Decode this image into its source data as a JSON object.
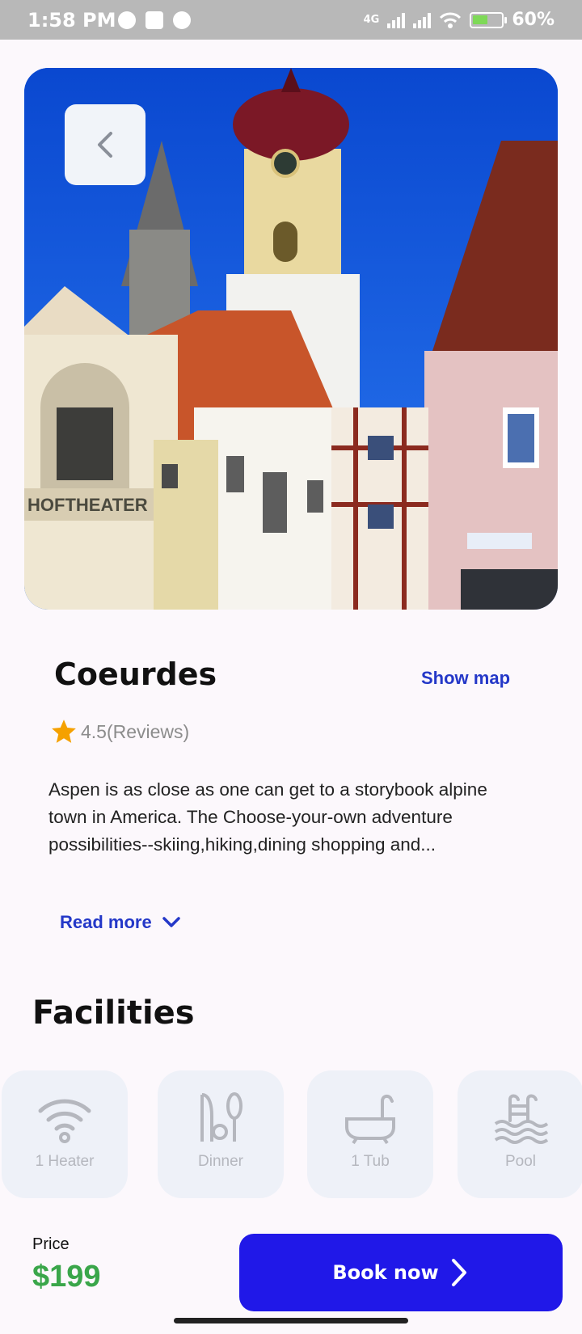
{
  "status_bar": {
    "time": "1:58 PM",
    "network": "4G",
    "battery": "60%"
  },
  "hero": {
    "back_icon": "chevron-left-icon",
    "image_description": "Colorful old town buildings with church tower under a blue sky"
  },
  "place": {
    "name": "Coeurdes",
    "show_map_label": "Show map",
    "rating": "4.5(Reviews)",
    "description": "Aspen is as close as one can get to a storybook alpine town in America. The Choose-your-own adventure possibilities--skiing,hiking,dining shopping and...",
    "read_more_label": "Read more"
  },
  "facilities": {
    "title": "Facilities",
    "items": [
      {
        "label": "1 Heater",
        "icon": "wifi-icon"
      },
      {
        "label": "Dinner",
        "icon": "cutlery-icon"
      },
      {
        "label": "1 Tub",
        "icon": "bathtub-icon"
      },
      {
        "label": "Pool",
        "icon": "pool-icon"
      }
    ]
  },
  "footer": {
    "price_label": "Price",
    "price_value": "$199",
    "book_label": "Book now"
  },
  "colors": {
    "accent": "#2018e8",
    "link": "#2438c8",
    "price": "#3aa64a",
    "star": "#f5a100"
  }
}
